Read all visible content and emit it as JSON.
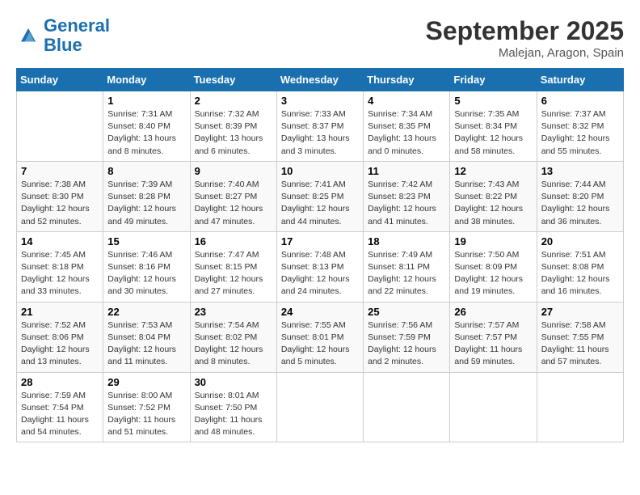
{
  "header": {
    "logo_line1": "General",
    "logo_line2": "Blue",
    "month": "September 2025",
    "location": "Malejan, Aragon, Spain"
  },
  "days_of_week": [
    "Sunday",
    "Monday",
    "Tuesday",
    "Wednesday",
    "Thursday",
    "Friday",
    "Saturday"
  ],
  "weeks": [
    [
      {
        "day": null
      },
      {
        "day": 1,
        "sunrise": "7:31 AM",
        "sunset": "8:40 PM",
        "daylight": "13 hours and 8 minutes."
      },
      {
        "day": 2,
        "sunrise": "7:32 AM",
        "sunset": "8:39 PM",
        "daylight": "13 hours and 6 minutes."
      },
      {
        "day": 3,
        "sunrise": "7:33 AM",
        "sunset": "8:37 PM",
        "daylight": "13 hours and 3 minutes."
      },
      {
        "day": 4,
        "sunrise": "7:34 AM",
        "sunset": "8:35 PM",
        "daylight": "13 hours and 0 minutes."
      },
      {
        "day": 5,
        "sunrise": "7:35 AM",
        "sunset": "8:34 PM",
        "daylight": "12 hours and 58 minutes."
      },
      {
        "day": 6,
        "sunrise": "7:37 AM",
        "sunset": "8:32 PM",
        "daylight": "12 hours and 55 minutes."
      }
    ],
    [
      {
        "day": 7,
        "sunrise": "7:38 AM",
        "sunset": "8:30 PM",
        "daylight": "12 hours and 52 minutes."
      },
      {
        "day": 8,
        "sunrise": "7:39 AM",
        "sunset": "8:28 PM",
        "daylight": "12 hours and 49 minutes."
      },
      {
        "day": 9,
        "sunrise": "7:40 AM",
        "sunset": "8:27 PM",
        "daylight": "12 hours and 47 minutes."
      },
      {
        "day": 10,
        "sunrise": "7:41 AM",
        "sunset": "8:25 PM",
        "daylight": "12 hours and 44 minutes."
      },
      {
        "day": 11,
        "sunrise": "7:42 AM",
        "sunset": "8:23 PM",
        "daylight": "12 hours and 41 minutes."
      },
      {
        "day": 12,
        "sunrise": "7:43 AM",
        "sunset": "8:22 PM",
        "daylight": "12 hours and 38 minutes."
      },
      {
        "day": 13,
        "sunrise": "7:44 AM",
        "sunset": "8:20 PM",
        "daylight": "12 hours and 36 minutes."
      }
    ],
    [
      {
        "day": 14,
        "sunrise": "7:45 AM",
        "sunset": "8:18 PM",
        "daylight": "12 hours and 33 minutes."
      },
      {
        "day": 15,
        "sunrise": "7:46 AM",
        "sunset": "8:16 PM",
        "daylight": "12 hours and 30 minutes."
      },
      {
        "day": 16,
        "sunrise": "7:47 AM",
        "sunset": "8:15 PM",
        "daylight": "12 hours and 27 minutes."
      },
      {
        "day": 17,
        "sunrise": "7:48 AM",
        "sunset": "8:13 PM",
        "daylight": "12 hours and 24 minutes."
      },
      {
        "day": 18,
        "sunrise": "7:49 AM",
        "sunset": "8:11 PM",
        "daylight": "12 hours and 22 minutes."
      },
      {
        "day": 19,
        "sunrise": "7:50 AM",
        "sunset": "8:09 PM",
        "daylight": "12 hours and 19 minutes."
      },
      {
        "day": 20,
        "sunrise": "7:51 AM",
        "sunset": "8:08 PM",
        "daylight": "12 hours and 16 minutes."
      }
    ],
    [
      {
        "day": 21,
        "sunrise": "7:52 AM",
        "sunset": "8:06 PM",
        "daylight": "12 hours and 13 minutes."
      },
      {
        "day": 22,
        "sunrise": "7:53 AM",
        "sunset": "8:04 PM",
        "daylight": "12 hours and 11 minutes."
      },
      {
        "day": 23,
        "sunrise": "7:54 AM",
        "sunset": "8:02 PM",
        "daylight": "12 hours and 8 minutes."
      },
      {
        "day": 24,
        "sunrise": "7:55 AM",
        "sunset": "8:01 PM",
        "daylight": "12 hours and 5 minutes."
      },
      {
        "day": 25,
        "sunrise": "7:56 AM",
        "sunset": "7:59 PM",
        "daylight": "12 hours and 2 minutes."
      },
      {
        "day": 26,
        "sunrise": "7:57 AM",
        "sunset": "7:57 PM",
        "daylight": "11 hours and 59 minutes."
      },
      {
        "day": 27,
        "sunrise": "7:58 AM",
        "sunset": "7:55 PM",
        "daylight": "11 hours and 57 minutes."
      }
    ],
    [
      {
        "day": 28,
        "sunrise": "7:59 AM",
        "sunset": "7:54 PM",
        "daylight": "11 hours and 54 minutes."
      },
      {
        "day": 29,
        "sunrise": "8:00 AM",
        "sunset": "7:52 PM",
        "daylight": "11 hours and 51 minutes."
      },
      {
        "day": 30,
        "sunrise": "8:01 AM",
        "sunset": "7:50 PM",
        "daylight": "11 hours and 48 minutes."
      },
      {
        "day": null
      },
      {
        "day": null
      },
      {
        "day": null
      },
      {
        "day": null
      }
    ]
  ]
}
